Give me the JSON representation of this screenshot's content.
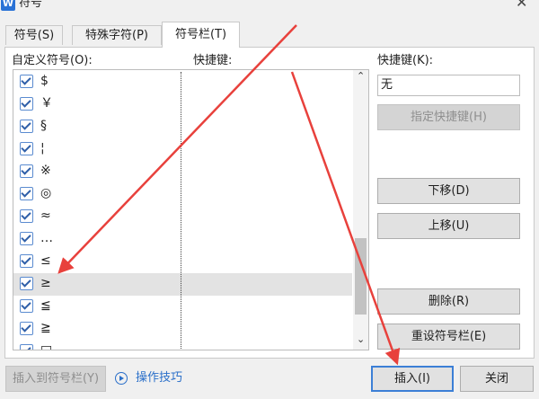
{
  "window": {
    "title": "符号",
    "app_icon": "W"
  },
  "tabs": [
    {
      "label": "符号(S)",
      "active": false
    },
    {
      "label": "特殊字符(P)",
      "active": false
    },
    {
      "label": "符号栏(T)",
      "active": true
    }
  ],
  "list": {
    "header_left": "自定义符号(O):",
    "header_right": "快捷键:",
    "items": [
      {
        "symbol": "$",
        "checked": true
      },
      {
        "symbol": "￥",
        "checked": true
      },
      {
        "symbol": "§",
        "checked": true
      },
      {
        "symbol": "¦",
        "checked": true
      },
      {
        "symbol": "※",
        "checked": true
      },
      {
        "symbol": "◎",
        "checked": true
      },
      {
        "symbol": "≈",
        "checked": true
      },
      {
        "symbol": "…",
        "checked": true
      },
      {
        "symbol": "≤",
        "checked": true
      },
      {
        "symbol": "≥",
        "checked": true,
        "selected": true
      },
      {
        "symbol": "≦",
        "checked": true
      },
      {
        "symbol": "≧",
        "checked": true
      },
      {
        "symbol": "□",
        "checked": true
      }
    ]
  },
  "shortcut": {
    "label": "快捷键(K):",
    "value": "无",
    "assign_button": "指定快捷键(H)"
  },
  "buttons": {
    "move_down": "下移(D)",
    "move_up": "上移(U)",
    "delete": "删除(R)",
    "reset": "重设符号栏(E)",
    "insert_to_bar": "插入到符号栏(Y)",
    "insert": "插入(I)",
    "close": "关闭"
  },
  "tips": {
    "label": "操作技巧"
  },
  "colors": {
    "accent": "#2a6fc9",
    "arrow": "#e8413c"
  }
}
